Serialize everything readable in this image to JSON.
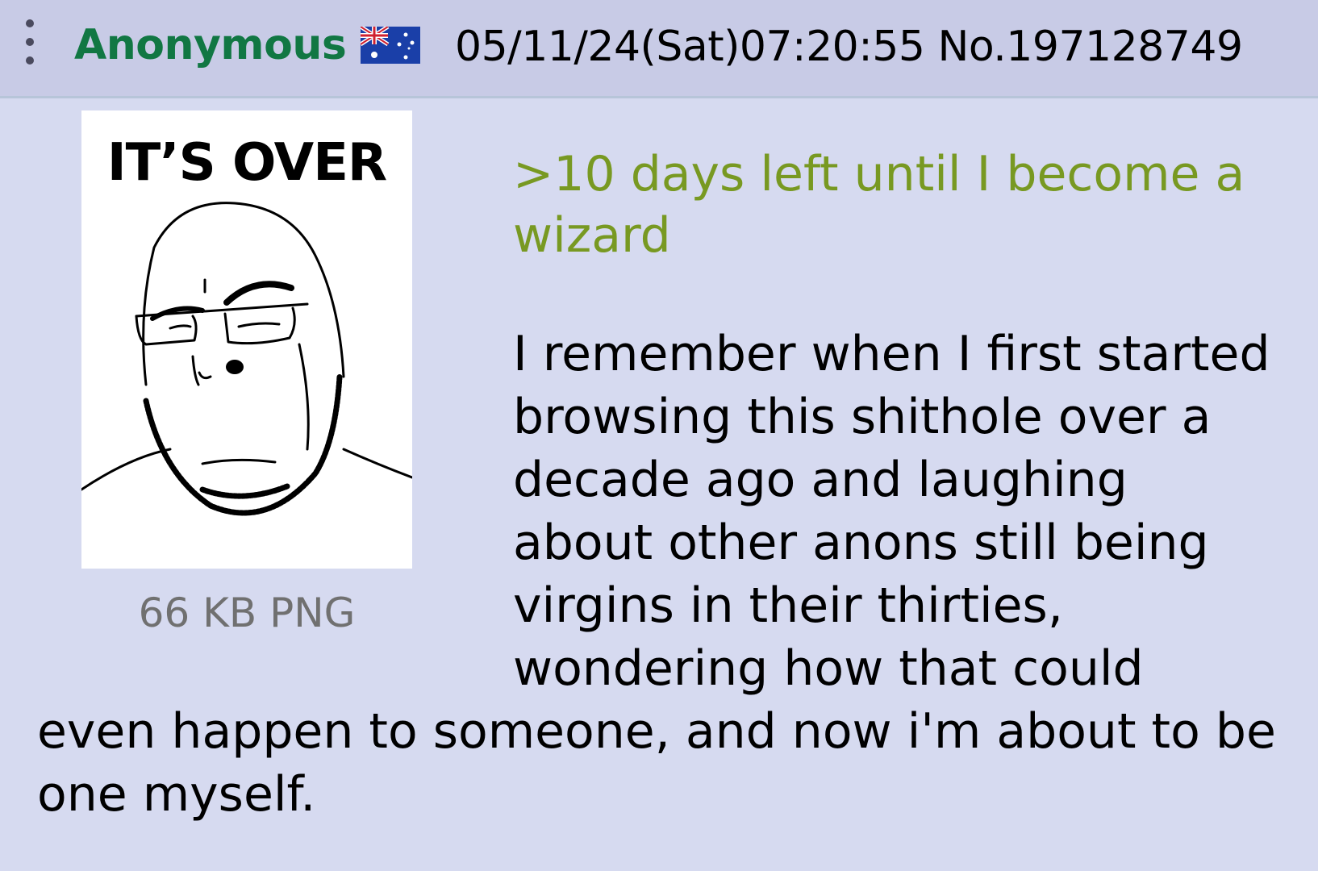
{
  "post": {
    "name": "Anonymous",
    "flag_icon": "australia-flag-icon",
    "datetime": "05/11/24(Sat)07:20:55",
    "number": "No.197128749"
  },
  "attachment": {
    "caption": "IT’S OVER",
    "file_info": "66 KB PNG"
  },
  "message": {
    "greentext": ">10 days left until I become a wizard",
    "lines": [
      "I remember when I first started",
      "browsing this shithole over a",
      "decade ago and laughing",
      "about other anons still being",
      "virgins in their thirties,",
      "wondering how that could",
      "even happen to someone, and now i'm about to be",
      "one myself."
    ]
  },
  "colors": {
    "background": "#d6daf0",
    "header_background": "#c8cbe6",
    "name_green": "#117743",
    "greentext": "#789922",
    "file_info_gray": "#707070"
  }
}
